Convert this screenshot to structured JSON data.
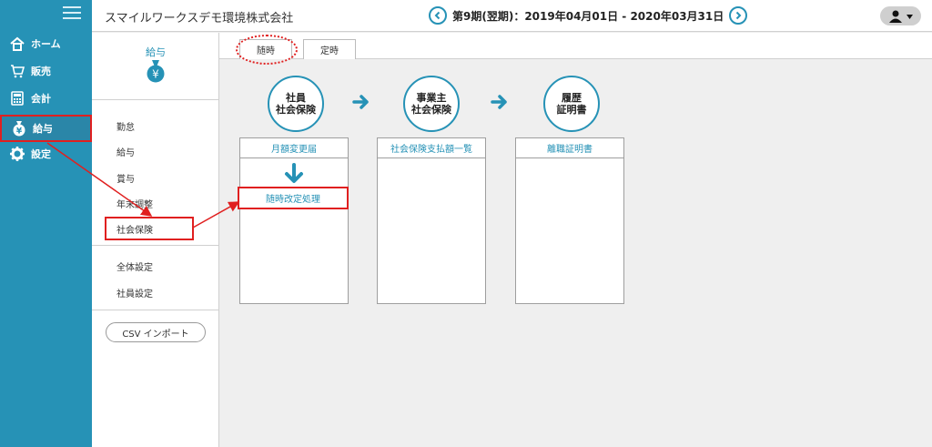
{
  "header": {
    "company": "スマイルワークスデモ環境株式会社",
    "period": "第9期(翌期)：2019年04月01日 - 2020年03月31日"
  },
  "nav": {
    "items": [
      {
        "label": "ホーム",
        "icon": "home-icon"
      },
      {
        "label": "販売",
        "icon": "cart-icon"
      },
      {
        "label": "会計",
        "icon": "calculator-icon"
      },
      {
        "label": "給与",
        "icon": "money-bag-icon"
      },
      {
        "label": "設定",
        "icon": "gear-icon"
      }
    ]
  },
  "subnav": {
    "title": "給与",
    "items": [
      "勤怠",
      "給与",
      "賞与",
      "年末調整",
      "社会保険"
    ],
    "items2": [
      "全体設定",
      "社員設定"
    ],
    "csv": "CSV インポート"
  },
  "tabs": [
    "随時",
    "定時"
  ],
  "steps": {
    "step1": [
      "社員",
      "社会保険"
    ],
    "step2": [
      "事業主",
      "社会保険"
    ],
    "step3": [
      "履歴",
      "証明書"
    ]
  },
  "columns": {
    "col1_head": "月額変更届",
    "col1_action": "随時改定処理",
    "col2_head": "社会保険支払額一覧",
    "col3_head": "離職証明書"
  },
  "colors": {
    "accent": "#2692b6",
    "highlight": "#e02020"
  }
}
